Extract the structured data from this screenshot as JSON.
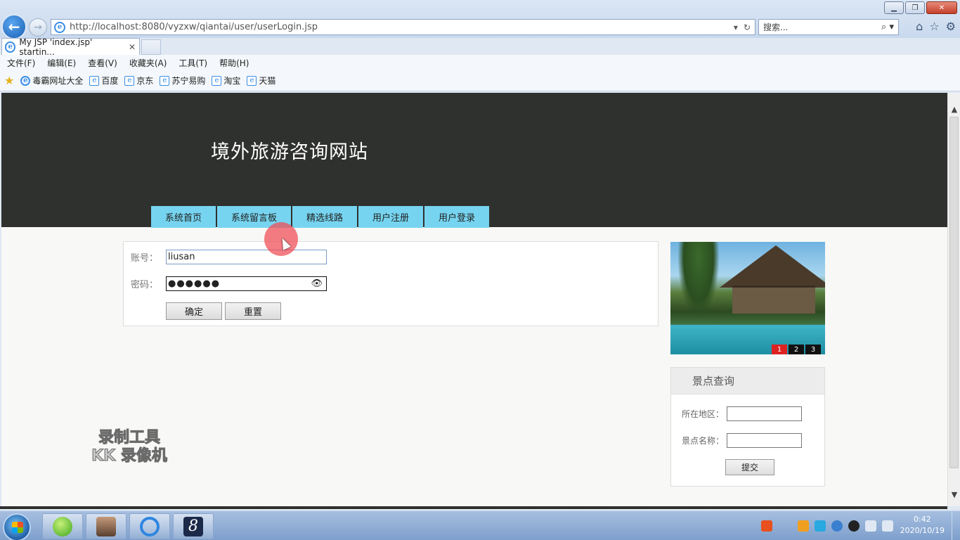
{
  "browser": {
    "url": "http://localhost:8080/vyzxw/qiantai/user/userLogin.jsp",
    "search_placeholder": "搜索...",
    "tab_title": "My JSP 'index.jsp' startin...",
    "menu": [
      "文件(F)",
      "编辑(E)",
      "查看(V)",
      "收藏夹(A)",
      "工具(T)",
      "帮助(H)"
    ],
    "favorites": [
      "毒霸网址大全",
      "百度",
      "京东",
      "苏宁易购",
      "淘宝",
      "天猫"
    ]
  },
  "site": {
    "title": "境外旅游咨询网站",
    "nav": [
      "系统首页",
      "系统留言板",
      "精选线路",
      "用户注册",
      "用户登录"
    ]
  },
  "login": {
    "account_label": "账号：",
    "account_value": "liusan",
    "password_label": "密码：",
    "password_mask": "●●●●●●",
    "submit_label": "确定",
    "reset_label": "重置"
  },
  "slider": {
    "pages": [
      "1",
      "2",
      "3"
    ],
    "active": "1"
  },
  "spot_search": {
    "title": "景点查询",
    "region_label": "所在地区：",
    "name_label": "景点名称：",
    "submit_label": "提交"
  },
  "watermark": {
    "line1": "录制工具",
    "line2": "KK 录像机"
  },
  "taskbar": {
    "time": "0:42",
    "date": "2020/10/19"
  },
  "colors": {
    "header_bg": "#2f312e",
    "nav_bg": "#76d4f0",
    "slider_active": "#dd2222"
  }
}
